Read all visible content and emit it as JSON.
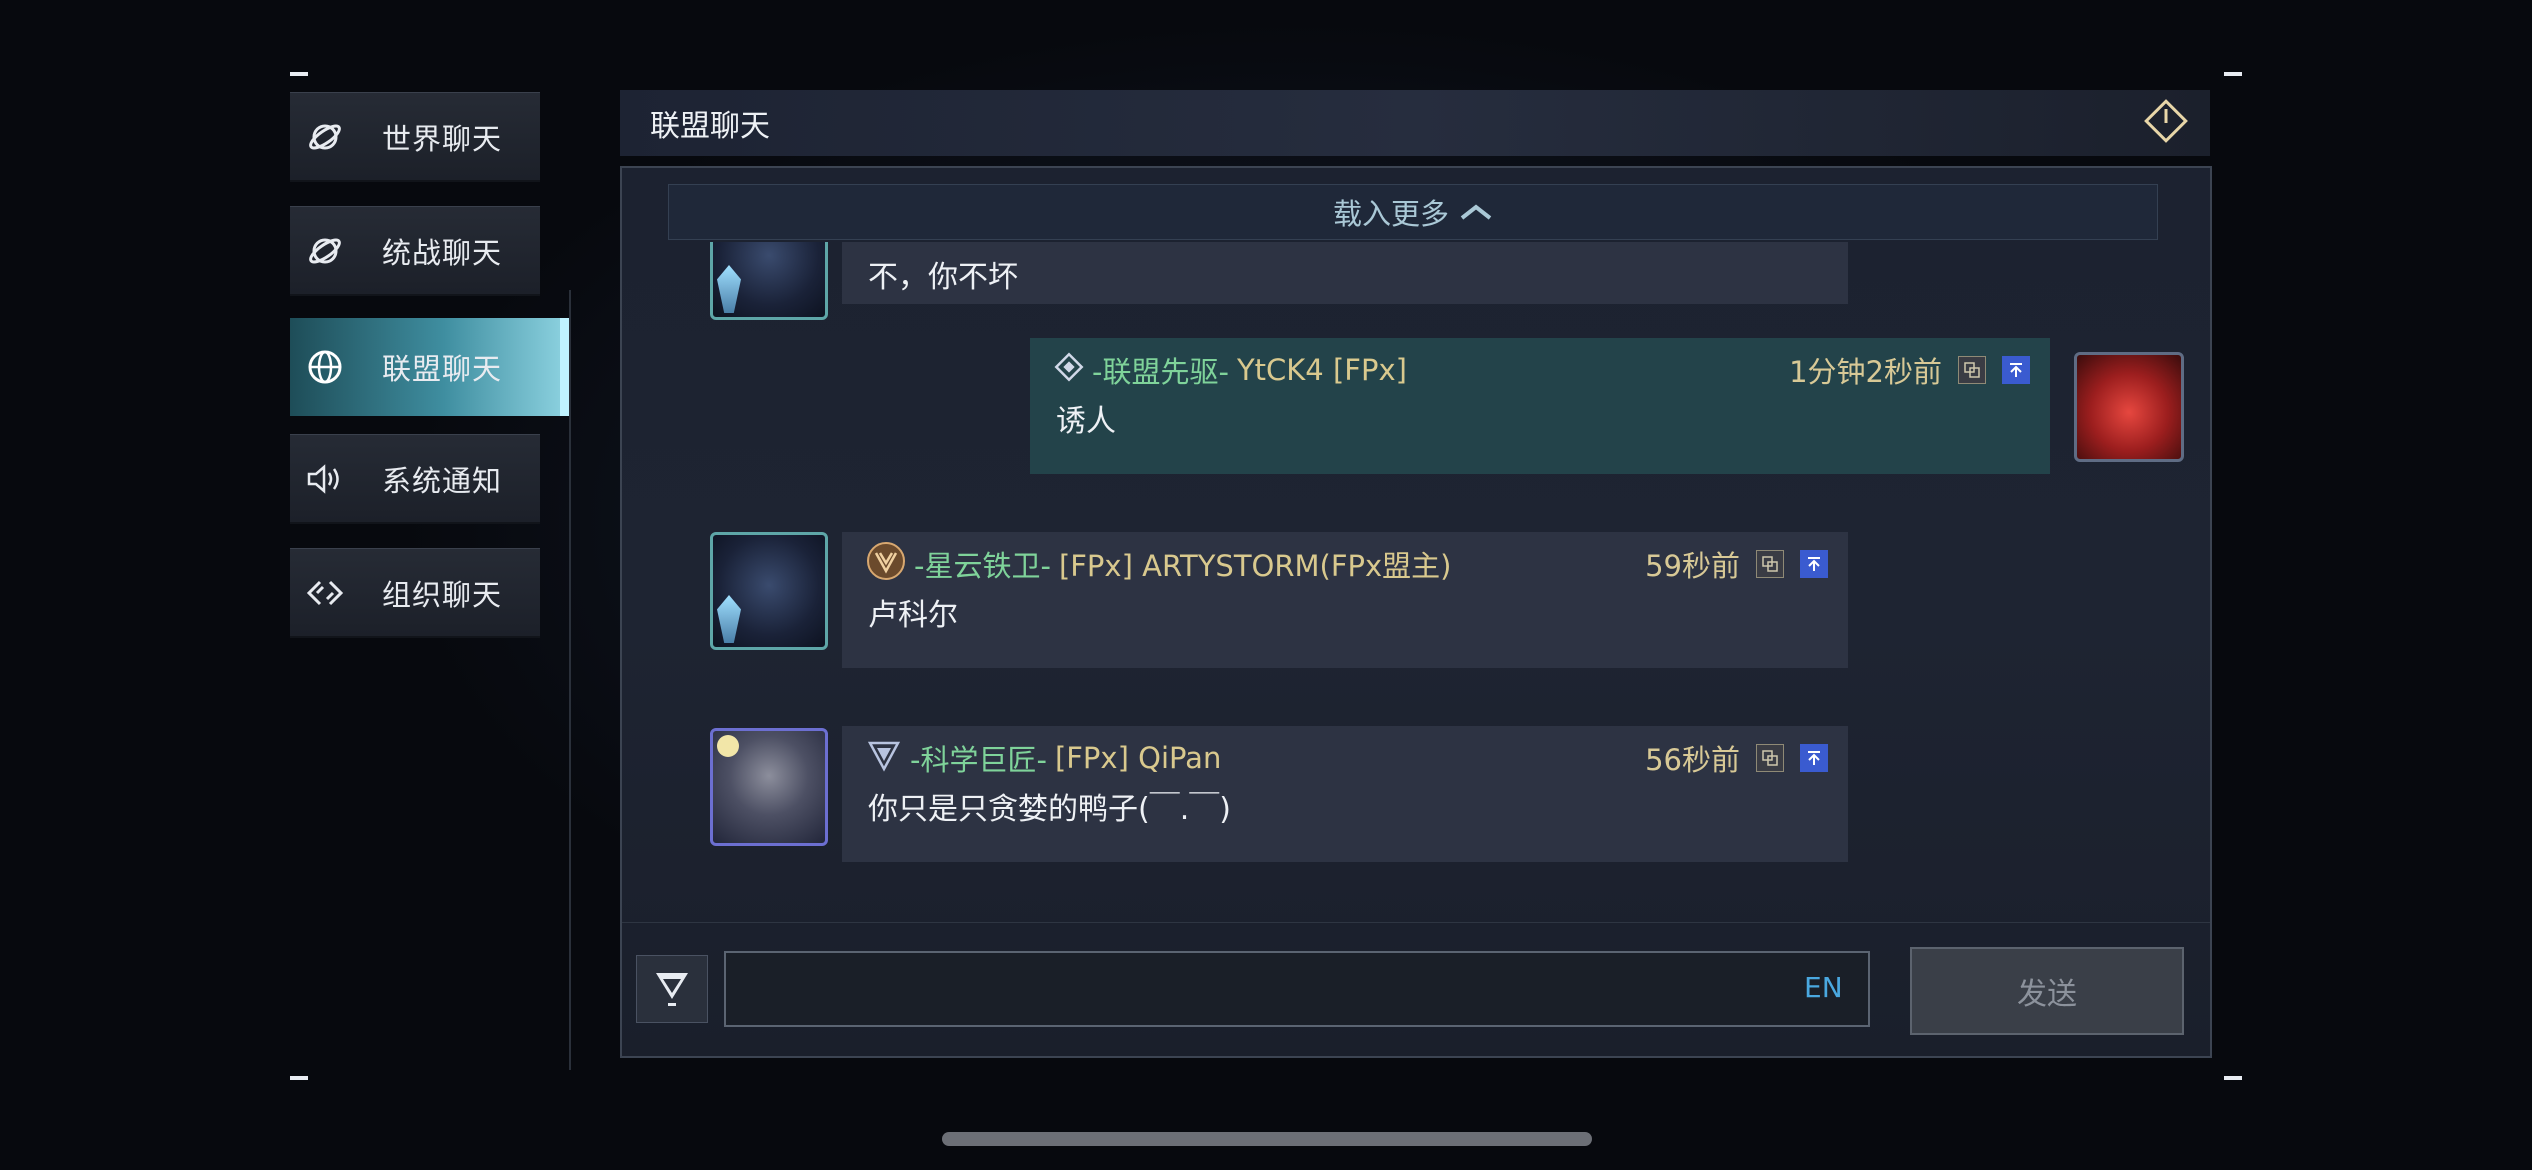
{
  "sidebar": {
    "items": [
      {
        "label": "世界聊天",
        "icon": "planet-icon"
      },
      {
        "label": "统战聊天",
        "icon": "planet-icon"
      },
      {
        "label": "联盟聊天",
        "icon": "globe-icon"
      },
      {
        "label": "系统通知",
        "icon": "speaker-icon"
      },
      {
        "label": "组织聊天",
        "icon": "link-icon"
      }
    ],
    "active_index": 2
  },
  "header": {
    "title": "联盟聊天",
    "power_icon": "power-icon"
  },
  "chat": {
    "load_more": "载入更多",
    "messages": [
      {
        "text": "不，你不坏"
      },
      {
        "rank": "-联盟先驱-",
        "name": "YtCK4 [FPx]",
        "time": "1分钟2秒前",
        "text": "诱人"
      },
      {
        "rank": "-星云铁卫-",
        "name": "[FPx] ARTYSTORM(FPx盟主)",
        "time": "59秒前",
        "text": "卢科尔"
      },
      {
        "rank": "-科学巨匠-",
        "name": "[FPx] QiPan",
        "time": "56秒前",
        "text": "你只是只贪婪的鸭子(￣.￣)"
      }
    ]
  },
  "input": {
    "value": "",
    "placeholder": "",
    "lang": "EN",
    "send_label": "发送"
  },
  "colors": {
    "accent": "#8fd4e2",
    "rank": "#7fd39a",
    "name": "#d9c98e",
    "lang": "#4aa8e0"
  }
}
